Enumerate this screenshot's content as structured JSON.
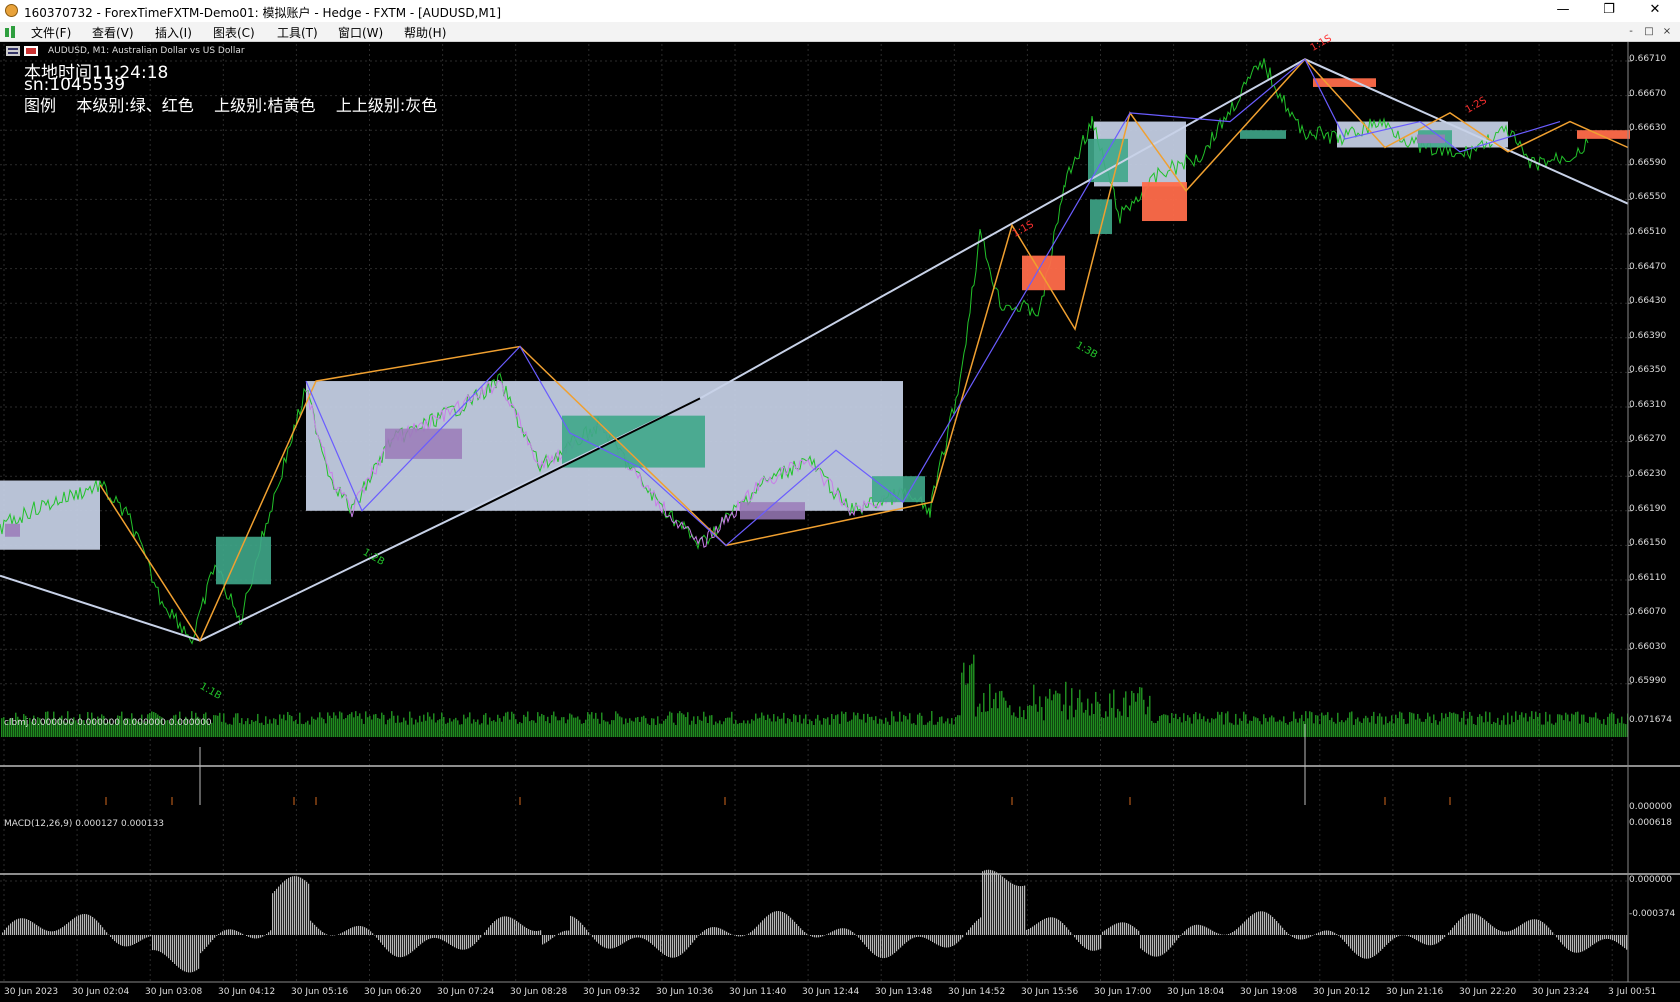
{
  "window": {
    "title": "160370732 - ForexTimeFXTM-Demo01: 模拟账户 - Hedge - FXTM - [AUDUSD,M1]",
    "minimize": "—",
    "restore": "❐",
    "close": "✕"
  },
  "menu": [
    "文件(F)",
    "查看(V)",
    "插入(I)",
    "图表(C)",
    "工具(T)",
    "窗口(W)",
    "帮助(H)"
  ],
  "mdi_buttons": [
    "-",
    "□",
    "×"
  ],
  "chart": {
    "symbol_label": "AUDUSD, M1:  Australian Dollar vs US Dollar",
    "local_time_label": "本地时间",
    "local_time": "11:24:18",
    "sn": "sn:1045539",
    "legend": "图例    本级别:绿、红色    上级别:桔黄色    上上级别:灰色",
    "price_ticks": [
      "0.66710",
      "0.66670",
      "0.66630",
      "0.66590",
      "0.66550",
      "0.66510",
      "0.66470",
      "0.66430",
      "0.66390",
      "0.66350",
      "0.66310",
      "0.66270",
      "0.66230",
      "0.66190",
      "0.66150",
      "0.66110",
      "0.66070",
      "0.66030",
      "0.65990"
    ],
    "time_ticks": [
      "30 Jun 2023",
      "30 Jun 02:04",
      "30 Jun 03:08",
      "30 Jun 04:12",
      "30 Jun 05:16",
      "30 Jun 06:20",
      "30 Jun 07:24",
      "30 Jun 08:28",
      "30 Jun 09:32",
      "30 Jun 10:36",
      "30 Jun 11:40",
      "30 Jun 12:44",
      "30 Jun 13:48",
      "30 Jun 14:52",
      "30 Jun 15:56",
      "30 Jun 17:00",
      "30 Jun 18:04",
      "30 Jun 19:08",
      "30 Jun 20:12",
      "30 Jun 21:16",
      "30 Jun 22:20",
      "30 Jun 23:24",
      "3 Jul 00:51"
    ],
    "pivot_labels": [
      "1:1B",
      "1:2B",
      "1:1S",
      "1:3B",
      "1:1S",
      "1:2S"
    ],
    "colors": {
      "bull": "#22c22a",
      "bear": "#ff3030",
      "upper_level": "#f0a030",
      "top_level": "#c8d2e8",
      "bull_box": "#3fa78a",
      "bear_box": "#ff6c4a"
    }
  },
  "indicator1": {
    "label": "clbmj 0.000000 0.000000 0.000000 0.000000",
    "ticks": [
      "0.071674",
      "0.000000"
    ]
  },
  "macd": {
    "label": "MACD(12,26,9) 0.000127 0.000133",
    "ticks": [
      "0.000618",
      "0.000000",
      "-0.000374"
    ]
  }
}
